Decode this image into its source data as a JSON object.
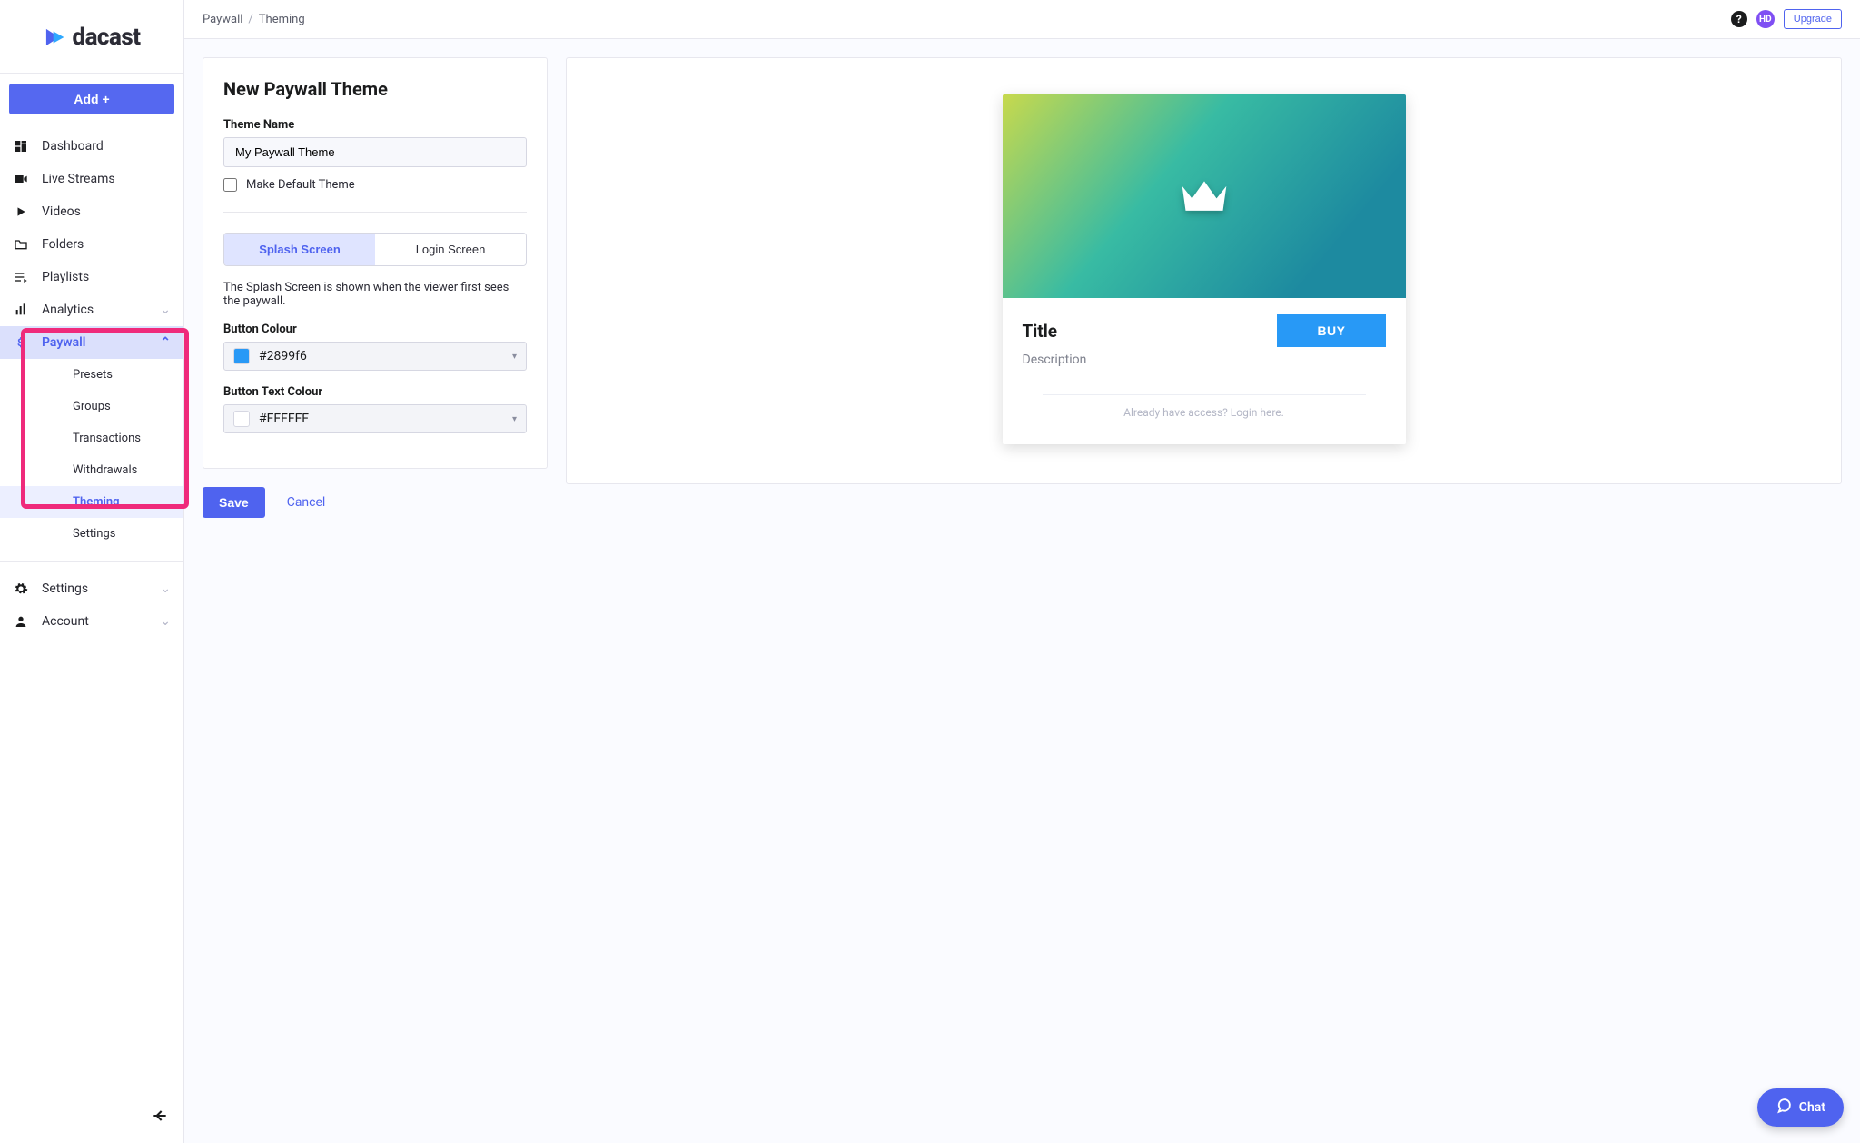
{
  "brand": "dacast",
  "sidebar": {
    "add_label": "Add +",
    "items": [
      {
        "label": "Dashboard"
      },
      {
        "label": "Live Streams"
      },
      {
        "label": "Videos"
      },
      {
        "label": "Folders"
      },
      {
        "label": "Playlists"
      },
      {
        "label": "Analytics"
      }
    ],
    "paywall": {
      "label": "Paywall",
      "sub": [
        {
          "label": "Presets"
        },
        {
          "label": "Groups"
        },
        {
          "label": "Transactions"
        },
        {
          "label": "Withdrawals"
        },
        {
          "label": "Theming"
        },
        {
          "label": "Settings"
        }
      ]
    },
    "footer_items": [
      {
        "label": "Settings"
      },
      {
        "label": "Account"
      }
    ]
  },
  "breadcrumb": {
    "a": "Paywall",
    "b": "Theming"
  },
  "topbar": {
    "hd": "HD",
    "upgrade": "Upgrade",
    "help": "?"
  },
  "form": {
    "title": "New Paywall Theme",
    "theme_name_label": "Theme Name",
    "theme_name_value": "My Paywall Theme",
    "make_default_label": "Make Default Theme",
    "tab_splash": "Splash Screen",
    "tab_login": "Login Screen",
    "splash_desc": "The Splash Screen is shown when the viewer first sees the paywall.",
    "btn_colour_label": "Button Colour",
    "btn_colour_value": "#2899f6",
    "btn_text_colour_label": "Button Text Colour",
    "btn_text_colour_value": "#FFFFFF",
    "save": "Save",
    "cancel": "Cancel"
  },
  "preview": {
    "title": "Title",
    "description": "Description",
    "buy": "BUY",
    "login_hint": "Already have access? Login here."
  },
  "chat": {
    "label": "Chat"
  }
}
